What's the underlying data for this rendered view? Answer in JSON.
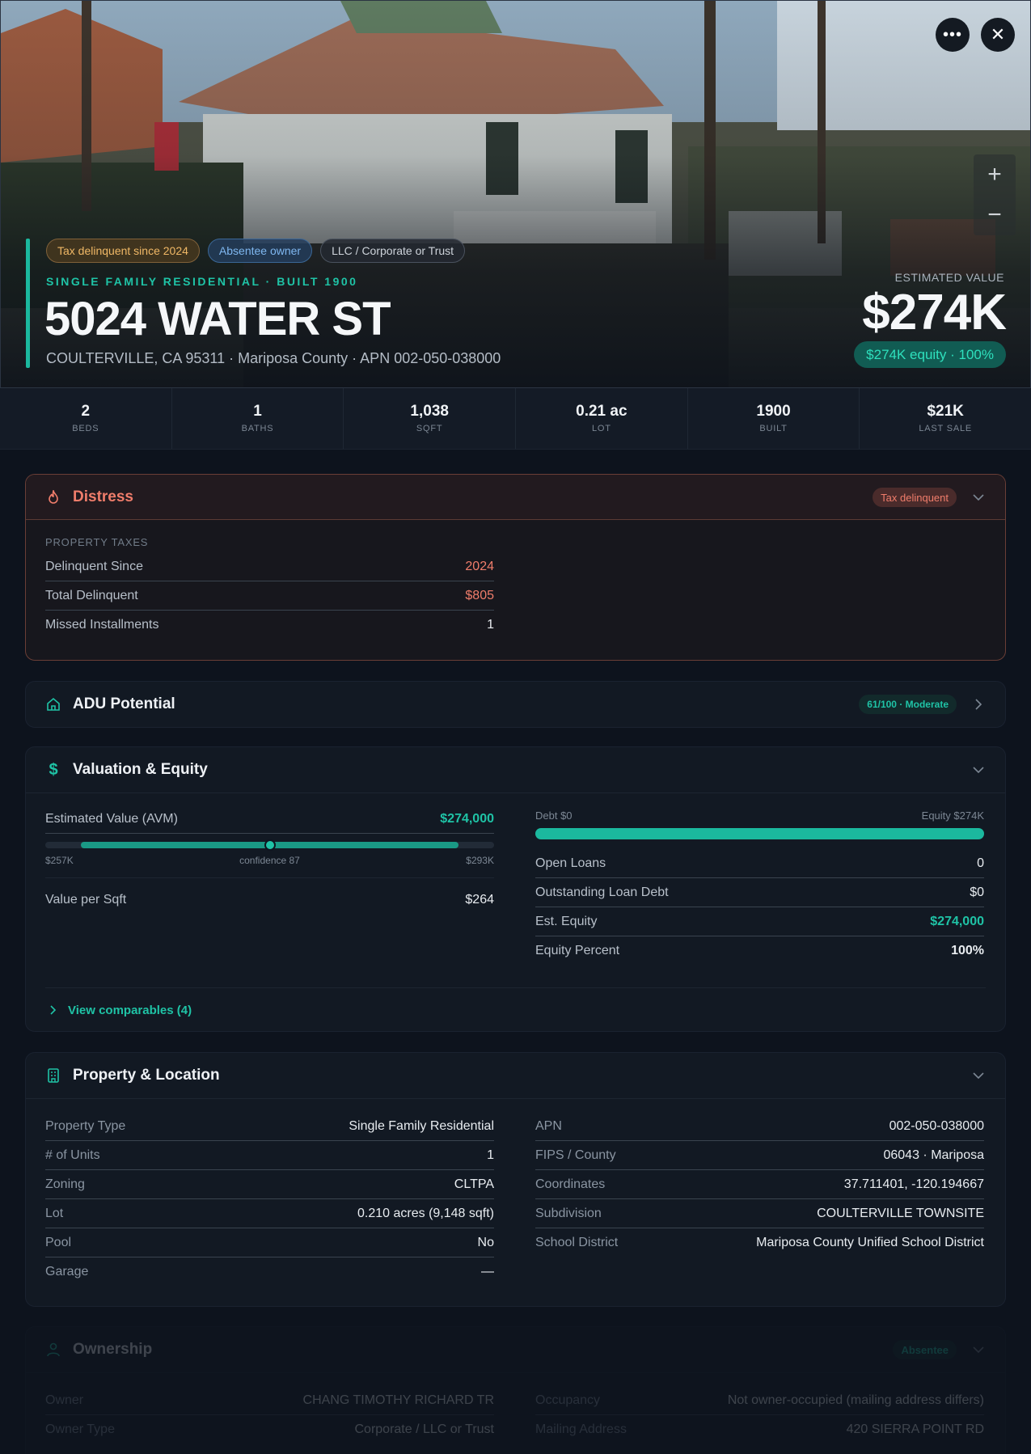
{
  "hero": {
    "chips": [
      "Tax delinquent since 2024",
      "Absentee owner",
      "LLC / Corporate or Trust"
    ],
    "subtitle": "SINGLE FAMILY RESIDENTIAL · BUILT 1900",
    "address": "5024 WATER ST",
    "address_sub": "COULTERVILLE, CA 95311 · Mariposa County · APN 002-050-038000",
    "estimated_label": "ESTIMATED VALUE",
    "estimated_value": "$274K",
    "equity_pill": "$274K equity · 100%",
    "more_icon": "more-horizontal-icon",
    "close_icon": "close-icon",
    "zoom_in": "+",
    "zoom_out": "−"
  },
  "stats": [
    {
      "value": "2",
      "label": "BEDS"
    },
    {
      "value": "1",
      "label": "BATHS"
    },
    {
      "value": "1,038",
      "label": "SQFT"
    },
    {
      "value": "0.21 ac",
      "label": "LOT"
    },
    {
      "value": "1900",
      "label": "BUILT"
    },
    {
      "value": "$21K",
      "label": "LAST SALE"
    }
  ],
  "distress": {
    "title": "Distress",
    "badge": "Tax delinquent",
    "section": "PROPERTY TAXES",
    "rows": [
      {
        "k": "Delinquent Since",
        "v": "2024"
      },
      {
        "k": "Total Delinquent",
        "v": "$805"
      },
      {
        "k": "Missed Installments",
        "v": "1"
      }
    ]
  },
  "adu": {
    "title": "ADU Potential",
    "badge": "61/100 · Moderate"
  },
  "valuation": {
    "title": "Valuation & Equity",
    "avm_label": "Estimated Value (AVM)",
    "avm_value": "$274,000",
    "range_low": "$257K",
    "range_mid": "confidence 87",
    "range_high": "$293K",
    "confidence": 87,
    "vps_label": "Value per Sqft",
    "vps_value": "$264",
    "debt_label": "Debt $0",
    "equity_label": "Equity $274K",
    "rows": [
      {
        "k": "Open Loans",
        "v": "0"
      },
      {
        "k": "Outstanding Loan Debt",
        "v": "$0"
      },
      {
        "k": "Est. Equity",
        "v": "$274,000"
      },
      {
        "k": "Equity Percent",
        "v": "100%"
      }
    ],
    "comparables": "View comparables (4)"
  },
  "property": {
    "title": "Property & Location",
    "left": [
      {
        "k": "Property Type",
        "v": "Single Family Residential"
      },
      {
        "k": "# of Units",
        "v": "1"
      },
      {
        "k": "Zoning",
        "v": "CLTPA"
      },
      {
        "k": "Lot",
        "v": "0.210 acres (9,148 sqft)"
      },
      {
        "k": "Pool",
        "v": "No"
      },
      {
        "k": "Garage",
        "v": "—"
      }
    ],
    "right": [
      {
        "k": "APN",
        "v": "002-050-038000"
      },
      {
        "k": "FIPS / County",
        "v": "06043 · Mariposa"
      },
      {
        "k": "Coordinates",
        "v": "37.711401, -120.194667"
      },
      {
        "k": "Subdivision",
        "v": "COULTERVILLE TOWNSITE"
      },
      {
        "k": "School District",
        "v": "Mariposa County Unified School District"
      }
    ]
  },
  "ownership": {
    "title": "Ownership",
    "badge": "Absentee",
    "left": [
      {
        "k": "Owner",
        "v": "CHANG TIMOTHY RICHARD TR"
      },
      {
        "k": "Owner Type",
        "v": "Corporate / LLC or Trust"
      }
    ],
    "right": [
      {
        "k": "Occupancy",
        "v": "Not owner-occupied (mailing address differs)"
      },
      {
        "k": "Mailing Address",
        "v": "420 SIERRA POINT RD"
      }
    ]
  },
  "colors": {
    "accent": "#1fc3a6",
    "danger": "#f07d6b",
    "tax_chip": "#f0b866",
    "absentee_chip": "#7fb7f0"
  }
}
